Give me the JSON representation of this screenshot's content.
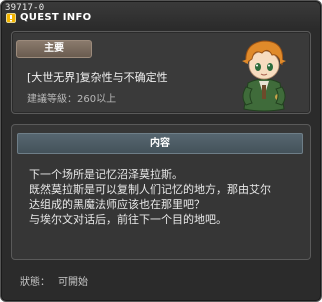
{
  "window": {
    "quest_id": "39717-0",
    "title": "QUEST INFO"
  },
  "quest": {
    "badge": "主要",
    "name": "[大世无界]复杂性与不确定性",
    "level_requirement": "建議等級：260以上"
  },
  "content": {
    "header": "内容",
    "lines": [
      "下一个场所是记忆沼泽莫拉斯。",
      "既然莫拉斯是可以复制人们记忆的地方，那由艾尔",
      "达组成的黑魔法师应该也在那里吧？",
      "与埃尔文对话后，前往下一个目的地吧。"
    ]
  },
  "status": {
    "label": "狀態：",
    "value": "可開始"
  },
  "colors": {
    "window_bg": "#2b2b2b",
    "panel_bg": "#3a3a3a",
    "badge_bg": "#7a6a5c",
    "header_bg": "#4c5a62"
  },
  "icons": {
    "title": "quest-info-icon",
    "npc": "npc-portrait-elvin"
  }
}
